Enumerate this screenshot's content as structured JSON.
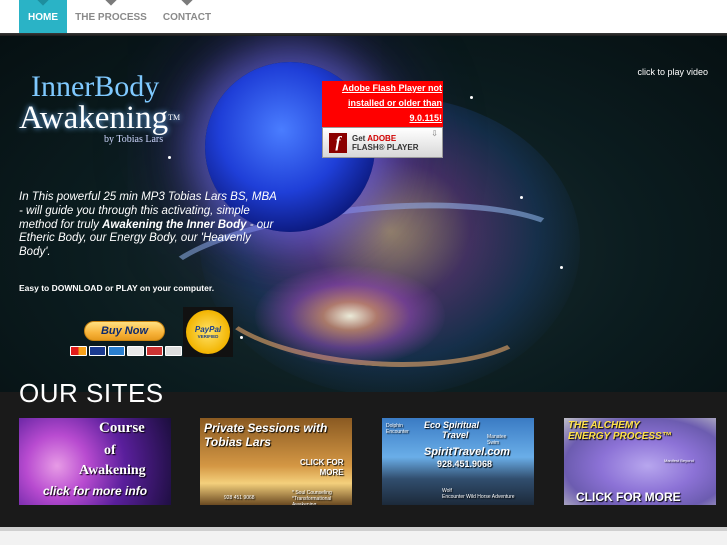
{
  "nav": {
    "items": [
      {
        "label": "HOME"
      },
      {
        "label": "THE PROCESS"
      },
      {
        "label": "CONTACT"
      }
    ]
  },
  "hero": {
    "logo": {
      "line1": "InnerBody",
      "line2": "Awakening",
      "trademark": "TM",
      "byline": "by Tobias Lars"
    },
    "flash": {
      "warning_line1": "Adobe Flash Player not",
      "warning_line2": "installed or older than",
      "warning_line3": "9.0.115!",
      "get": "Get",
      "adobe": "ADOBE",
      "product": "FLASH® PLAYER"
    },
    "click_to_play": "click to play video",
    "description": {
      "part1": "In This powerful 25 min MP3 Tobias Lars BS, MBA - will guide you through this activating, simple method for truly ",
      "bold": "Awakening the Inner Body",
      "part2": " - our Etheric Body, our Energy Body, our 'Heavenly Body'."
    },
    "easy": "Easy to DOWNLOAD or PLAY on your computer.",
    "buy_now": "Buy Now",
    "paypal": {
      "name": "PayPal",
      "verified": "VERIFIED"
    }
  },
  "sites": {
    "title": "OUR SITES",
    "thumbs": [
      {
        "l1": "Course",
        "l2": "of",
        "l3": "Awakening",
        "l4": "click for more info"
      },
      {
        "l1": "Private Sessions with Tobias Lars",
        "l2a": "CLICK FOR",
        "l2b": "MORE",
        "l3": "928 451 9068",
        "l4a": "* Soul Counseling",
        "l4b": "*Transformational Awakening"
      },
      {
        "l1": "Eco Spiritual",
        "l2": "Travel",
        "l3a": "Dolphin",
        "l3b": "Encounter",
        "l4a": "Manatee",
        "l4b": "Swim",
        "l5": "SpiritTravel.com",
        "l6": "928.451.9068",
        "l7a": "Wolf",
        "l7b": "Encounter Wild Horse Adventure"
      },
      {
        "l1a": "THE ALCHEMY",
        "l1b": "ENERGY PROCESS™",
        "l2": "Manifest Beyond",
        "l3": "CLICK FOR MORE"
      }
    ]
  },
  "colors": {
    "accent": "#2ab3c6",
    "hero_bg": "#0b1c1f",
    "flash_red": "#ff0000",
    "button_gold": "#f8b43b"
  }
}
